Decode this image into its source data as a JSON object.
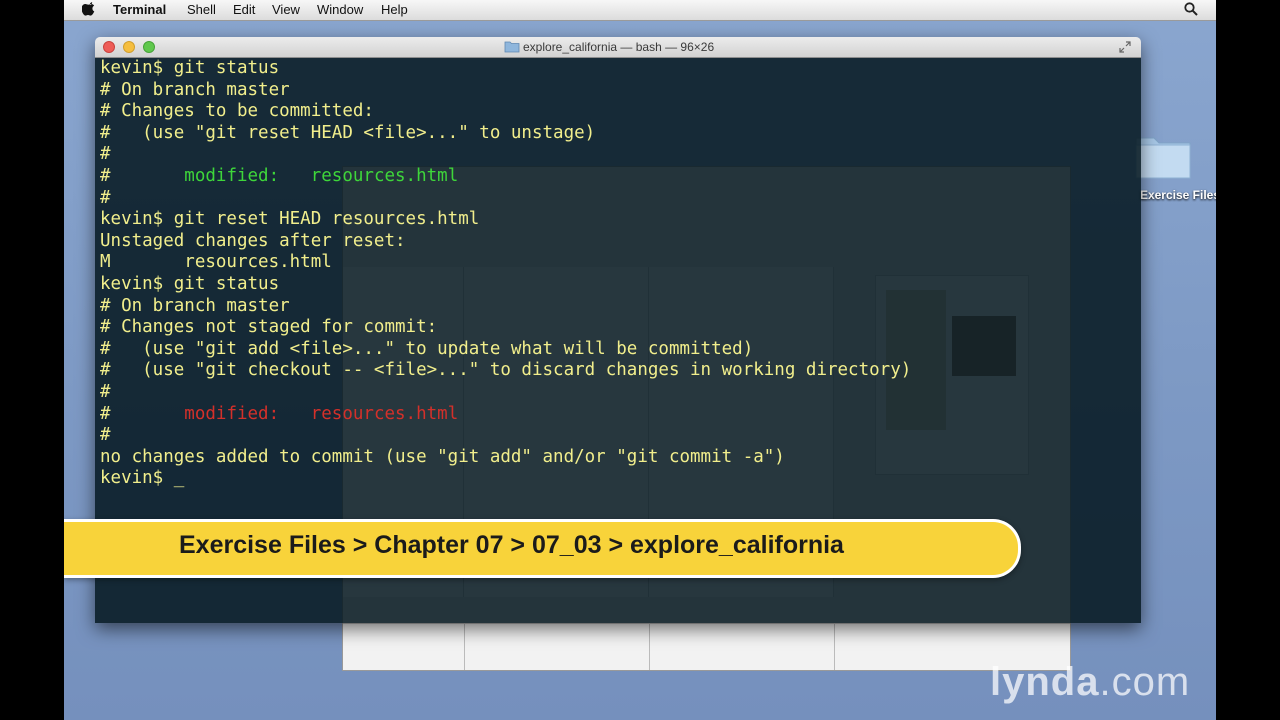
{
  "menubar": {
    "app_name": "Terminal",
    "items": [
      "Shell",
      "Edit",
      "View",
      "Window",
      "Help"
    ],
    "icons": [
      "apple-icon",
      "spotlight-search-icon"
    ]
  },
  "desktop": {
    "folder_label": "Exercise Files"
  },
  "terminal": {
    "title": "explore_california — bash — 96×26",
    "colors": {
      "text": "#f1ee8c",
      "staged": "#3ed63a",
      "unstaged": "#d3302a",
      "background": "#04161e"
    },
    "lines": [
      "kevin$ git status",
      "# On branch master",
      "# Changes to be committed:",
      "#   (use \"git reset HEAD <file>...\" to unstage)",
      "#",
      {
        "prefix": "#       ",
        "colored": "modified:   resources.html",
        "color": "green"
      },
      "#",
      "kevin$ git reset HEAD resources.html",
      "Unstaged changes after reset:",
      "M       resources.html",
      "kevin$ git status",
      "# On branch master",
      "# Changes not staged for commit:",
      "#   (use \"git add <file>...\" to update what will be committed)",
      "#   (use \"git checkout -- <file>...\" to discard changes in working directory)",
      "#",
      {
        "prefix": "#       ",
        "colored": "modified:   resources.html",
        "color": "red"
      },
      "#",
      "no changes added to commit (use \"git add\" and/or \"git commit -a\")",
      "kevin$ _"
    ]
  },
  "breadcrumb": {
    "text": "Exercise Files > Chapter 07 > 07_03 > explore_california",
    "color": "#f8d33a"
  },
  "watermark": {
    "brand": "lynda",
    "suffix": ".com"
  }
}
